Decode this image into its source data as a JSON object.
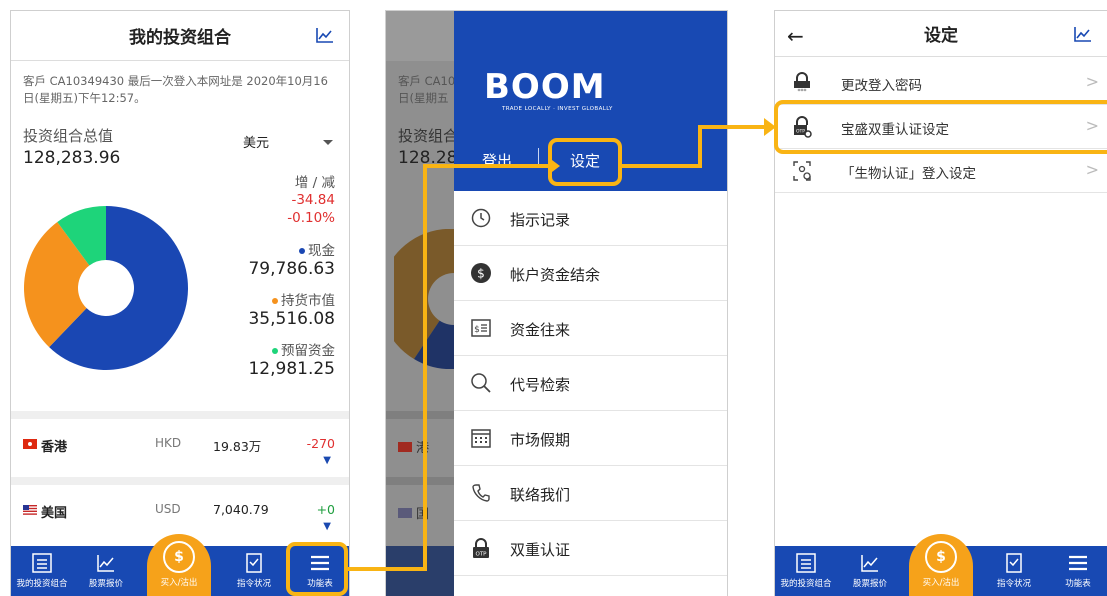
{
  "portfolio": {
    "title": "我的投资组合",
    "login_info": "客戶 CA10349430 最后一次登入本网址是 2020年10月16日(星期五)下午12:57。",
    "total_label": "投资组合总值",
    "total_value": "128,283.96",
    "currency": "美元",
    "change_label": "增 / 减",
    "change_amount": "-34.84",
    "change_pct": "-0.10%",
    "cash_label": "现金",
    "cash_value": "79,786.63",
    "holdings_label": "持货市值",
    "holdings_value": "35,516.08",
    "reserved_label": "预留资金",
    "reserved_value": "12,981.25",
    "donut": [
      {
        "name": "现金",
        "value": 79786.63,
        "color": "#1a47b3"
      },
      {
        "name": "持货市值",
        "value": 35516.08,
        "color": "#f5921d"
      },
      {
        "name": "预留资金",
        "value": 12981.25,
        "color": "#1ed47a"
      }
    ],
    "markets": [
      {
        "name": "香港",
        "currency": "HKD",
        "value": "19.83万",
        "change": "-270",
        "change_color": "#e03030"
      },
      {
        "name": "美国",
        "currency": "USD",
        "value": "7,040.79",
        "change": "+0",
        "change_color": "#1e9e3e"
      }
    ]
  },
  "tabbar": {
    "portfolio": "我的投资组合",
    "quotes": "股票报价",
    "trade": "买入/沽出",
    "orders": "指令状况",
    "menu": "功能表"
  },
  "side_menu": {
    "dim_info": "客戶 CA10\n日(星期五",
    "dim_total_label": "投资组合",
    "dim_total_value": "128.28",
    "logo": "BOOM",
    "tagline": "TRADE LOCALLY · INVEST GLOBALLY",
    "logout": "登出",
    "settings": "设定",
    "items": [
      {
        "label": "指示记录",
        "icon": "history-icon"
      },
      {
        "label": "帐户资金结余",
        "icon": "dollar-icon"
      },
      {
        "label": "资金往来",
        "icon": "transfer-icon"
      },
      {
        "label": "代号检索",
        "icon": "search-icon"
      },
      {
        "label": "市场假期",
        "icon": "calendar-icon"
      },
      {
        "label": "联络我们",
        "icon": "phone-icon"
      },
      {
        "label": "双重认证",
        "icon": "otp-lock-icon"
      }
    ],
    "dim_markets": [
      "港",
      "国"
    ]
  },
  "settings": {
    "title": "设定",
    "items": [
      {
        "label": "更改登入密码",
        "icon": "password-lock-icon"
      },
      {
        "label": "宝盛双重认证设定",
        "icon": "otp-settings-icon"
      },
      {
        "label": "「生物认证」登入设定",
        "icon": "biometric-icon"
      }
    ]
  },
  "colors": {
    "brand_blue": "#1849b3",
    "accent_orange": "#f6a21a",
    "highlight": "#f9b414"
  }
}
